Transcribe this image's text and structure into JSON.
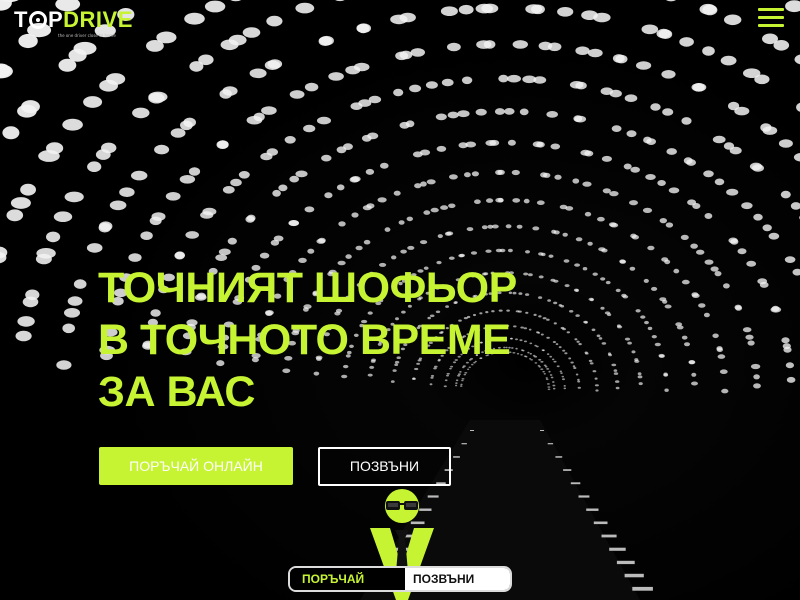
{
  "header": {
    "logo": {
      "top": "T",
      "wheel_letter": "O",
      "mid": "P",
      "drive": "DRIVE",
      "tagline": "the one driver close to home"
    },
    "menu_icon": "hamburger-menu-icon"
  },
  "hero": {
    "headline": [
      "ТОЧНИЯТ ШОФЬОР",
      "В ТОЧНОТО ВРЕМЕ",
      "ЗА ВАС"
    ],
    "order_button": "ПОРЪЧАЙ ОНЛАЙН",
    "call_button": "ПОЗВЪНИ"
  },
  "bottom_bar": {
    "order": "ПОРЪЧАЙ",
    "call": "ПОЗВЪНИ"
  },
  "colors": {
    "accent": "#c6f433",
    "background": "#000000",
    "text_light": "#ffffff"
  }
}
